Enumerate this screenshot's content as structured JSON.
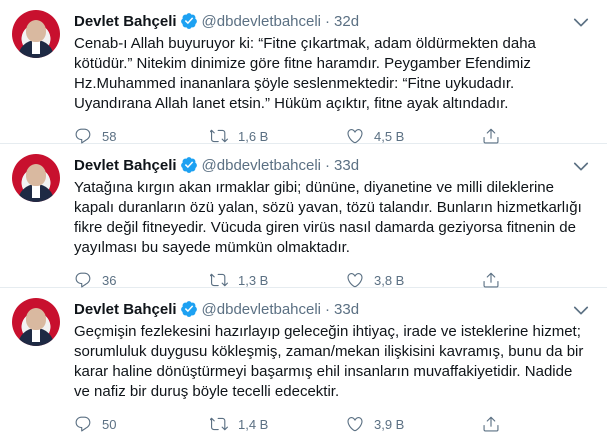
{
  "tweets": [
    {
      "author_name": "Devlet Bahçeli",
      "handle": "@dbdevletbahceli",
      "separator": "·",
      "time": "32d",
      "text": "Cenab-ı Allah buyuruyor ki: “Fitne çıkartmak, adam öldürmekten daha\nkötüdür.” Nitekim dinimize göre fitne haramdır. Peygamber Efendimiz\nHz.Muhammed inananlara şöyle seslenmektedir: “Fitne uykudadır.\nUyandırana Allah lanet etsin.” Hüküm açıktır, fitne ayak altındadır.",
      "replies": "58",
      "retweets": "1,6 B",
      "likes": "4,5 B"
    },
    {
      "author_name": "Devlet Bahçeli",
      "handle": "@dbdevletbahceli",
      "separator": "·",
      "time": "33d",
      "text": "Yatağına kırgın akan ırmaklar gibi; dününe, diyanetine ve milli dileklerine\nkapalı duranların özü yalan, sözü yavan, tözü talandır. Bunların hizmetkarlığı\nfikre değil fitneyedir. Vücuda giren virüs nasıl damarda geziyorsa fitnenin de\nyayılması bu sayede mümkün olmaktadır.",
      "replies": "36",
      "retweets": "1,3 B",
      "likes": "3,8 B"
    },
    {
      "author_name": "Devlet Bahçeli",
      "handle": "@dbdevletbahceli",
      "separator": "·",
      "time": "33d",
      "text": "Geçmişin fezlekesini hazırlayıp geleceğin ihtiyaç, irade ve isteklerine hizmet;\nsorumluluk duygusu kökleşmiş, zaman/mekan ilişkisini kavramış, bunu da bir\nkarar haline dönüştürmeyi başarmış ehil insanların muvaffakiyetidir. Nadide\nve nafiz bir duruş böyle tecelli edecektir.",
      "replies": "50",
      "retweets": "1,4 B",
      "likes": "3,9 B"
    }
  ],
  "colors": {
    "text": "#0f1419",
    "muted": "#5b7083",
    "verified": "#1da1f2",
    "divider": "#e6ecf0"
  },
  "icons": [
    "verified-badge-icon",
    "more-options-icon",
    "reply-icon",
    "retweet-icon",
    "like-icon",
    "share-icon"
  ]
}
